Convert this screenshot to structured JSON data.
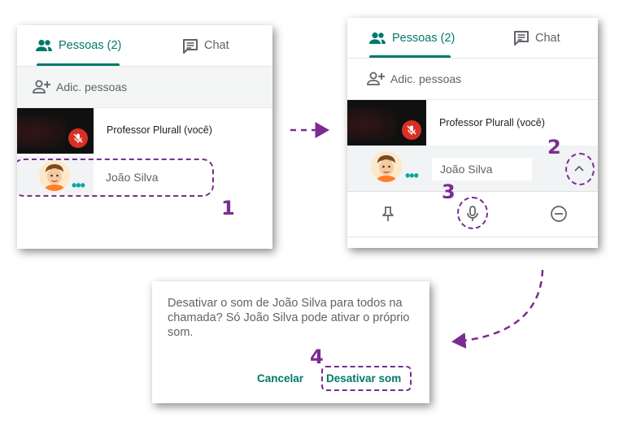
{
  "panel1": {
    "tab_people": "Pessoas (2)",
    "tab_chat": "Chat",
    "add_people": "Adic. pessoas",
    "participant_1": "Professor Plurall (você)",
    "participant_2": "João Silva",
    "participant_2_dots": "•••"
  },
  "panel2": {
    "tab_people": "Pessoas (2)",
    "tab_chat": "Chat",
    "add_people": "Adic. pessoas",
    "participant_1": "Professor Plurall (você)",
    "participant_2": "João Silva",
    "participant_2_dots": "•••"
  },
  "dialog": {
    "message": "Desativar o som de João Silva para todos na chamada? Só João Silva pode ativar o próprio som.",
    "cancel_label": "Cancelar",
    "confirm_label": "Desativar som"
  },
  "steps": {
    "s1": "1",
    "s2": "2",
    "s3": "3",
    "s4": "4"
  },
  "colors": {
    "accent": "#00796b",
    "annotation": "#7b2c91",
    "mute": "#d93025"
  }
}
